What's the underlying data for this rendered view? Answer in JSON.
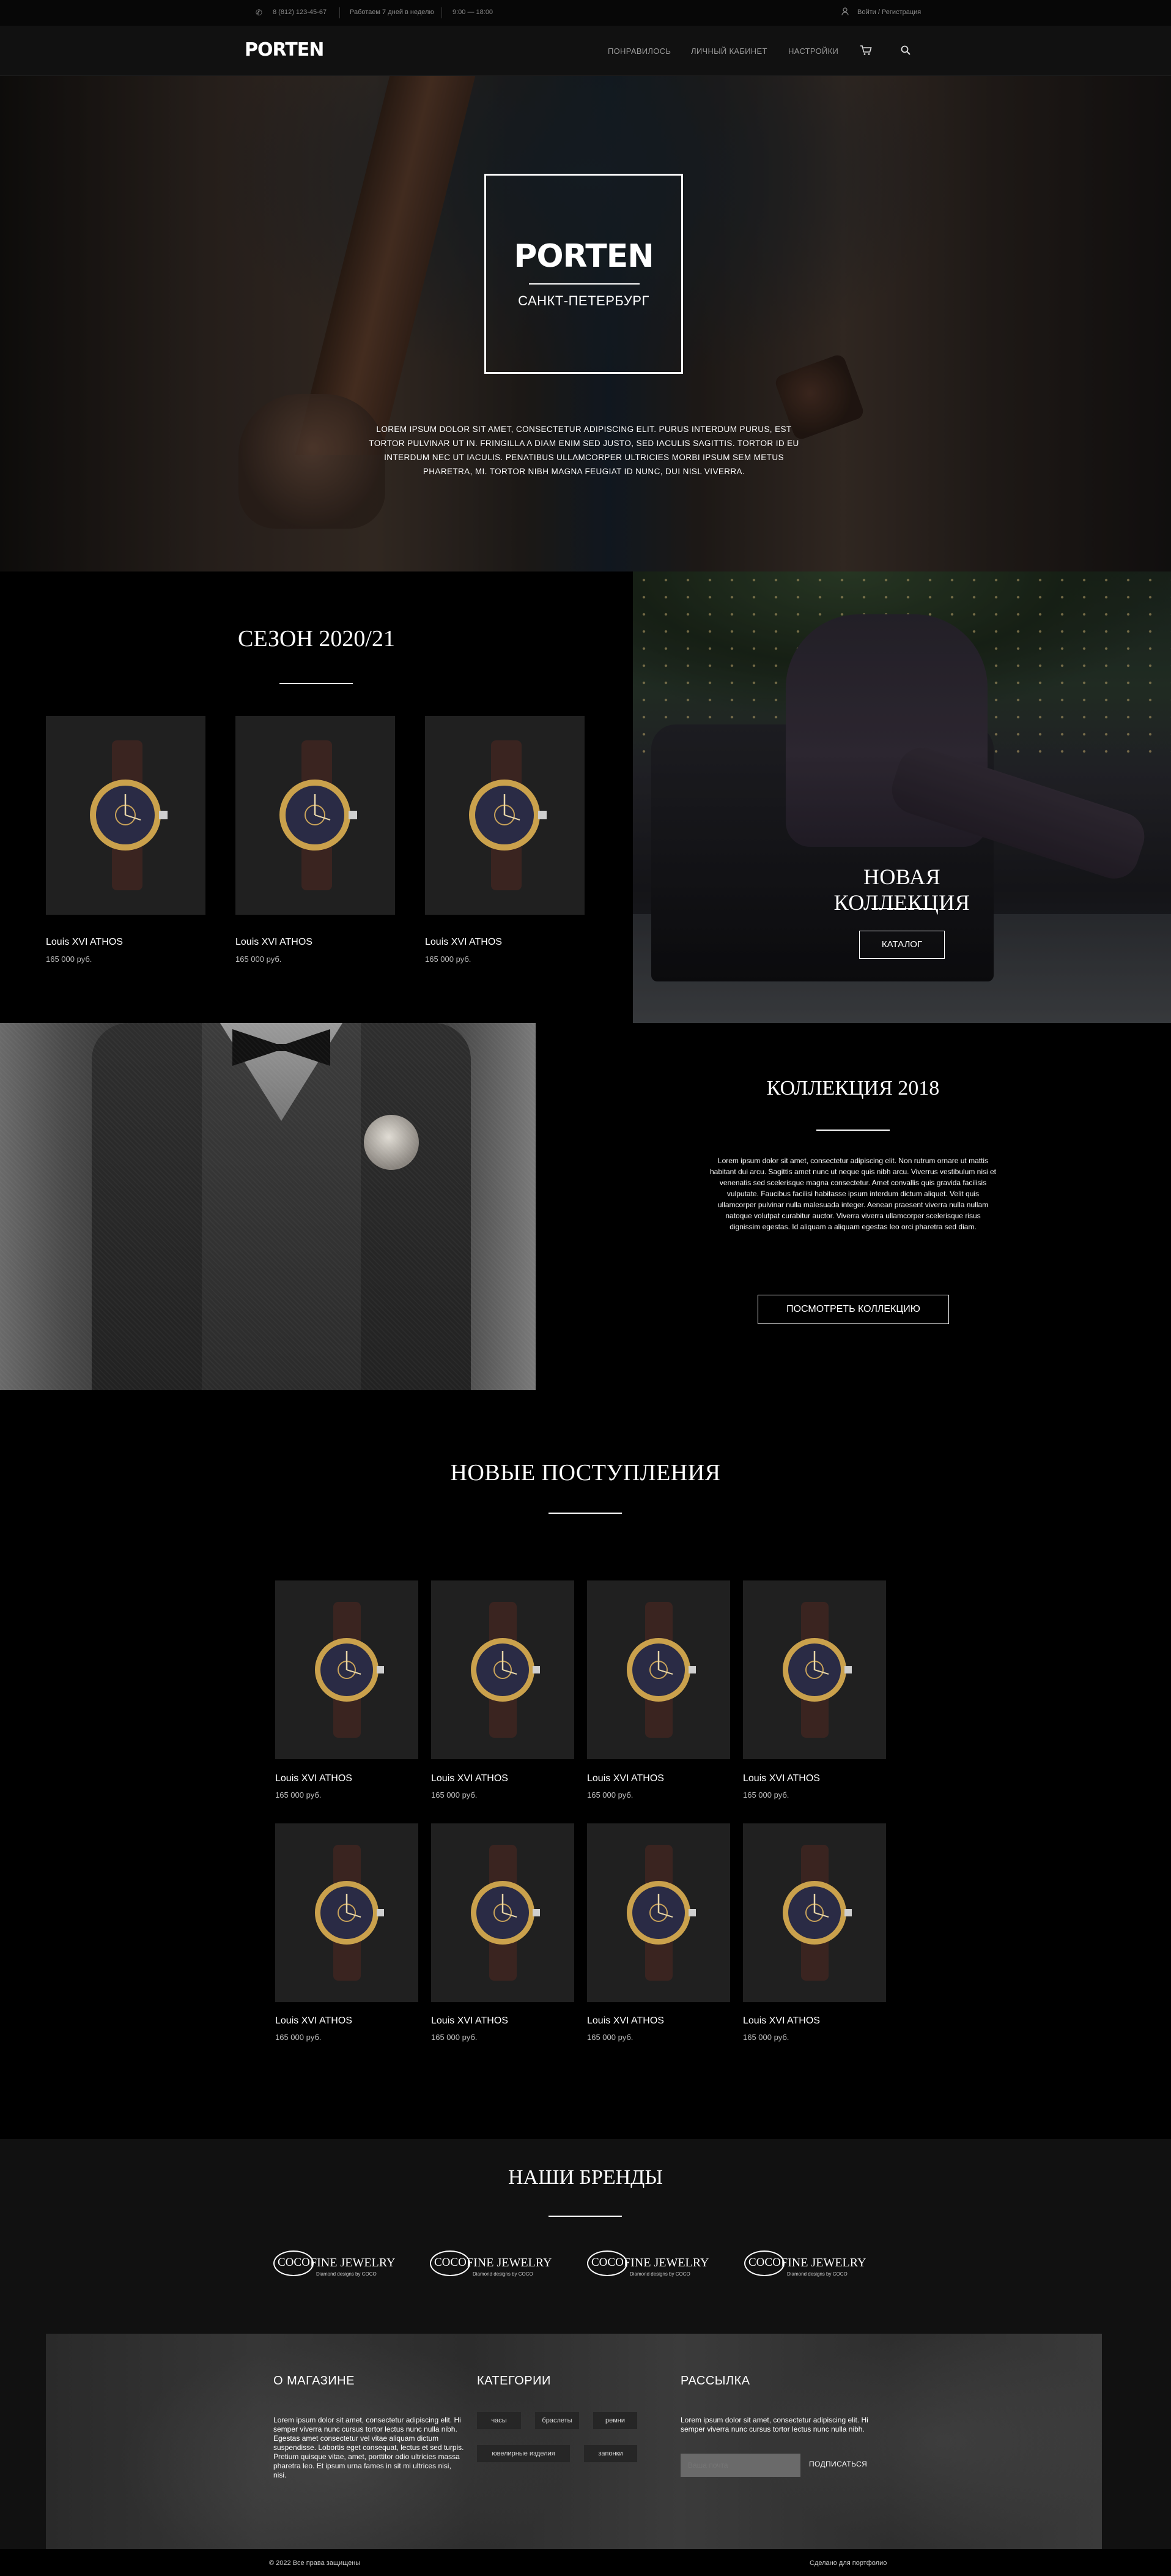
{
  "topbar": {
    "phone": "8 (812) 123-45-67",
    "hours_days": "Работаем 7 дней в неделю",
    "hours_time": "9:00 — 18:00",
    "login": "Войти / Регистрация"
  },
  "header": {
    "logo": "PORTEN",
    "nav": [
      "ПОНРАВИЛОСЬ",
      "ЛИЧНЫЙ КАБИНЕТ",
      "НАСТРОЙКИ"
    ],
    "cart_icon": "cart-icon",
    "search_icon": "search-icon"
  },
  "hero": {
    "title": "PORTEN",
    "subtitle": "САНКТ-ПЕТЕРБУРГ",
    "description": "LOREM IPSUM DOLOR SIT AMET, CONSECTETUR ADIPISCING ELIT. PURUS INTERDUM PURUS, EST TORTOR PULVINAR UT IN. FRINGILLA A DIAM ENIM SED JUSTO, SED IACULIS SAGITTIS. TORTOR ID EU INTERDUM NEC UT IACULIS. PENATIBUS ULLAMCORPER ULTRICIES MORBI IPSUM SEM METUS PHARETRA, MI. TORTOR NIBH MAGNA FEUGIAT ID NUNC, DUI NISL VIVERRA."
  },
  "season": {
    "title": "СЕЗОН 2020/21",
    "products": [
      {
        "name": "Louis XVI ATHOS",
        "price": "165 000 руб."
      },
      {
        "name": "Louis XVI ATHOS",
        "price": "165 000 руб."
      },
      {
        "name": "Louis XVI ATHOS",
        "price": "165 000 руб."
      }
    ]
  },
  "new_collection": {
    "title": "НОВАЯ КОЛЛЕКЦИЯ",
    "button": "КАТАЛОГ"
  },
  "collection_2018": {
    "title": "КОЛЛЕКЦИЯ 2018",
    "text": "Lorem ipsum dolor sit amet, consectetur adipiscing elit. Non rutrum ornare ut mattis habitant dui arcu. Sagittis amet nunc ut neque quis nibh arcu. Viverrus vestibulum nisi et venenatis sed scelerisque magna consectetur. Amet convallis quis gravida facilisis vulputate. Faucibus facilisi habitasse ipsum interdum dictum aliquet. Velit quis ullamcorper pulvinar nulla malesuada integer. Aenean praesent viverra nulla nullam natoque volutpat curabitur auctor. Viverra viverra ullamcorper scelerisque risus dignissim egestas. Id aliquam a aliquam egestas leo orci pharetra sed diam.",
    "button": "ПОСМОТРЕТЬ КОЛЛЕКЦИЮ"
  },
  "arrivals": {
    "title": "НОВЫЕ ПОСТУПЛЕНИЯ",
    "products": [
      {
        "name": "Louis XVI ATHOS",
        "price": "165 000 руб."
      },
      {
        "name": "Louis XVI ATHOS",
        "price": "165 000 руб."
      },
      {
        "name": "Louis XVI ATHOS",
        "price": "165 000 руб."
      },
      {
        "name": "Louis XVI ATHOS",
        "price": "165 000 руб."
      },
      {
        "name": "Louis XVI ATHOS",
        "price": "165 000 руб."
      },
      {
        "name": "Louis XVI ATHOS",
        "price": "165 000 руб."
      },
      {
        "name": "Louis XVI ATHOS",
        "price": "165 000 руб."
      },
      {
        "name": "Louis XVI ATHOS",
        "price": "165 000 руб."
      }
    ]
  },
  "brands": {
    "title": "НАШИ БРЕНДЫ",
    "items": [
      {
        "oval": "COCO",
        "name": "FINE JEWELRY",
        "tagline": "Diamond designs by COCO"
      },
      {
        "oval": "COCO",
        "name": "FINE JEWELRY",
        "tagline": "Diamond designs by COCO"
      },
      {
        "oval": "COCO",
        "name": "FINE JEWELRY",
        "tagline": "Diamond designs by COCO"
      },
      {
        "oval": "COCO",
        "name": "FINE JEWELRY",
        "tagline": "Diamond designs by COCO"
      }
    ]
  },
  "footer": {
    "about_title": "О МАГАЗИНЕ",
    "about_text": "Lorem ipsum dolor sit amet, consectetur adipiscing elit. Hi semper viverra nunc cursus tortor lectus nunc nulla nibh. Egestas amet consectetur vel vitae aliquam dictum suspendisse. Lobortis eget consequat, lectus et sed turpis. Pretium quisque vitae, amet, porttitor odio ultricies massa pharetra leo. Et ipsum urna fames in sit mi ultrices nisi, nisi.",
    "categories_title": "КАТЕГОРИИ",
    "categories": [
      "часы",
      "браслеты",
      "ремни",
      "ювелирные изделия",
      "запонки"
    ],
    "newsletter_title": "РАССЫЛКА",
    "newsletter_text": "Lorem ipsum dolor sit amet, consectetur adipiscing elit. Hi semper viverra nunc cursus tortor lectus nunc nulla nibh.",
    "email_placeholder": "Ваша почта",
    "subscribe": "ПОДПИСАТЬСЯ"
  },
  "bottom": {
    "copyright": "© 2022 Все права защищены",
    "credit": "Сделано для портфолио"
  }
}
